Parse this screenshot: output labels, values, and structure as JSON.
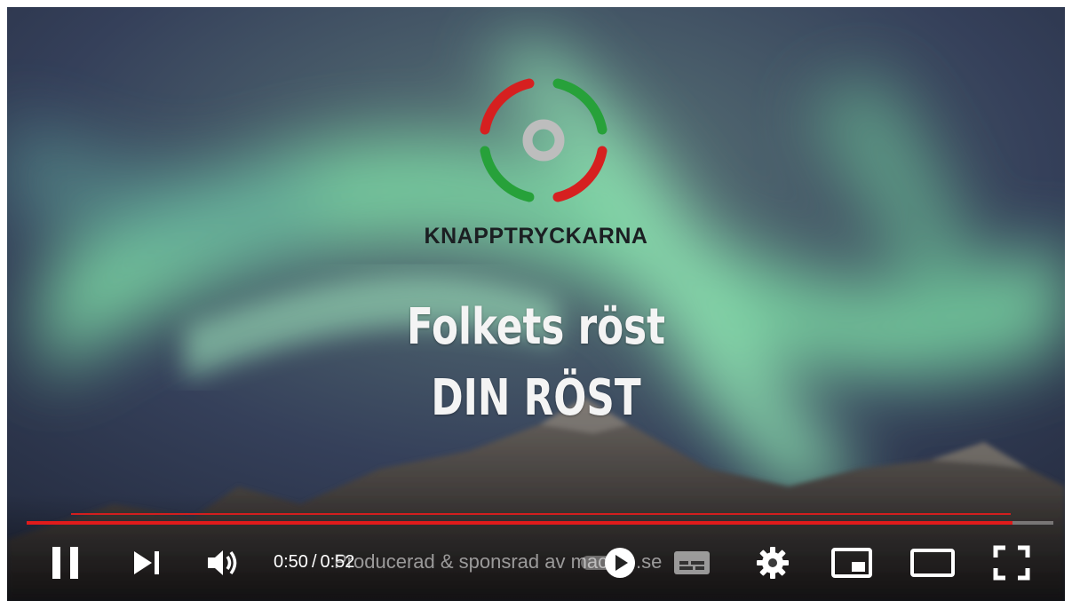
{
  "video": {
    "brand_name": "KNAPPTRYCKARNA",
    "headline_line1": "Folkets röst",
    "headline_line2": "DIN RÖST",
    "credit_text": "Producerad & sponsrad av macore.se",
    "current_time": "0:50",
    "time_separator": "/",
    "duration": "0:52",
    "progress": 0.96
  },
  "controls": {
    "icons": [
      "pause-icon",
      "next-icon",
      "volume-icon",
      "autoplay-toggle-icon",
      "subtitles-icon",
      "settings-icon",
      "miniplayer-icon",
      "theater-mode-icon",
      "fullscreen-icon"
    ]
  },
  "colors": {
    "progress": "#e01b1b",
    "logo_red": "#d62020",
    "logo_green": "#27a13a",
    "logo_center": "#bdbdbd"
  }
}
